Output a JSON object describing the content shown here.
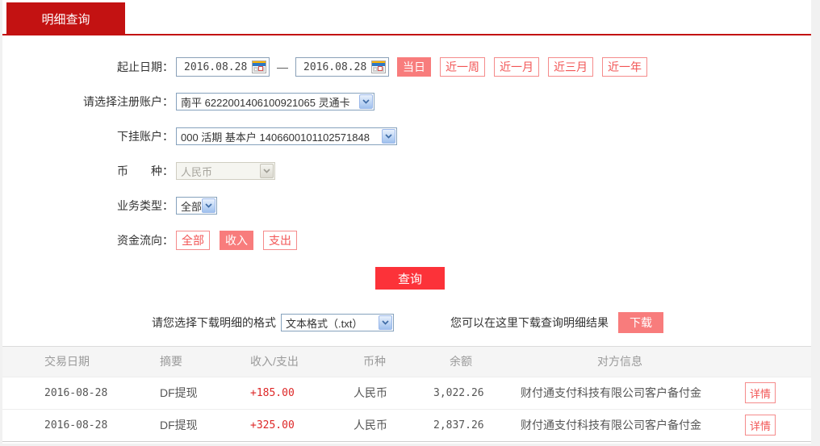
{
  "tab": {
    "title": "明细查询"
  },
  "form": {
    "date_label": "起止日期：",
    "date_from": "2016.08.28",
    "date_to": "2016.08.28",
    "date_separator": "—",
    "quick_ranges": [
      {
        "label": "当日",
        "active": true
      },
      {
        "label": "近一周",
        "active": false
      },
      {
        "label": "近一月",
        "active": false
      },
      {
        "label": "近三月",
        "active": false
      },
      {
        "label": "近一年",
        "active": false
      }
    ],
    "register_account_label": "请选择注册账户：",
    "register_account_value": "南平 6222001406100921065 灵通卡",
    "sub_account_label": "下挂账户：",
    "sub_account_value": "000 活期 基本户 1406600101102571848",
    "currency_label": "币　　种：",
    "currency_value": "人民币",
    "business_type_label": "业务类型：",
    "business_type_value": "全部",
    "fund_flow_label": "资金流向：",
    "fund_flow_options": [
      {
        "label": "全部",
        "active": false
      },
      {
        "label": "收入",
        "active": true
      },
      {
        "label": "支出",
        "active": false
      }
    ],
    "query_button": "查询"
  },
  "download": {
    "format_label": "请您选择下载明细的格式",
    "format_value": "文本格式（.txt）",
    "hint": "您可以在这里下载查询明细结果",
    "download_button": "下载"
  },
  "table": {
    "headers": [
      "交易日期",
      "摘要",
      "收入/支出",
      "币种",
      "余额",
      "对方信息"
    ],
    "detail_button": "详情",
    "rows": [
      {
        "date": "2016-08-28",
        "summary": "DF提现",
        "amount": "+185.00",
        "currency": "人民币",
        "balance": "3,022.26",
        "counterparty": "财付通支付科技有限公司客户备付金"
      },
      {
        "date": "2016-08-28",
        "summary": "DF提现",
        "amount": "+325.00",
        "currency": "人民币",
        "balance": "2,837.26",
        "counterparty": "财付通支付科技有限公司客户备付金"
      }
    ]
  },
  "colors": {
    "tab_red": "#c31212",
    "query_red": "#fc3239",
    "pink_fill": "#f87c7c",
    "pink_border": "#f58b8b",
    "amount_red": "#dd2727"
  },
  "icons": {
    "calendar": "calendar-icon",
    "chevron_down": "chevron-down-icon"
  }
}
